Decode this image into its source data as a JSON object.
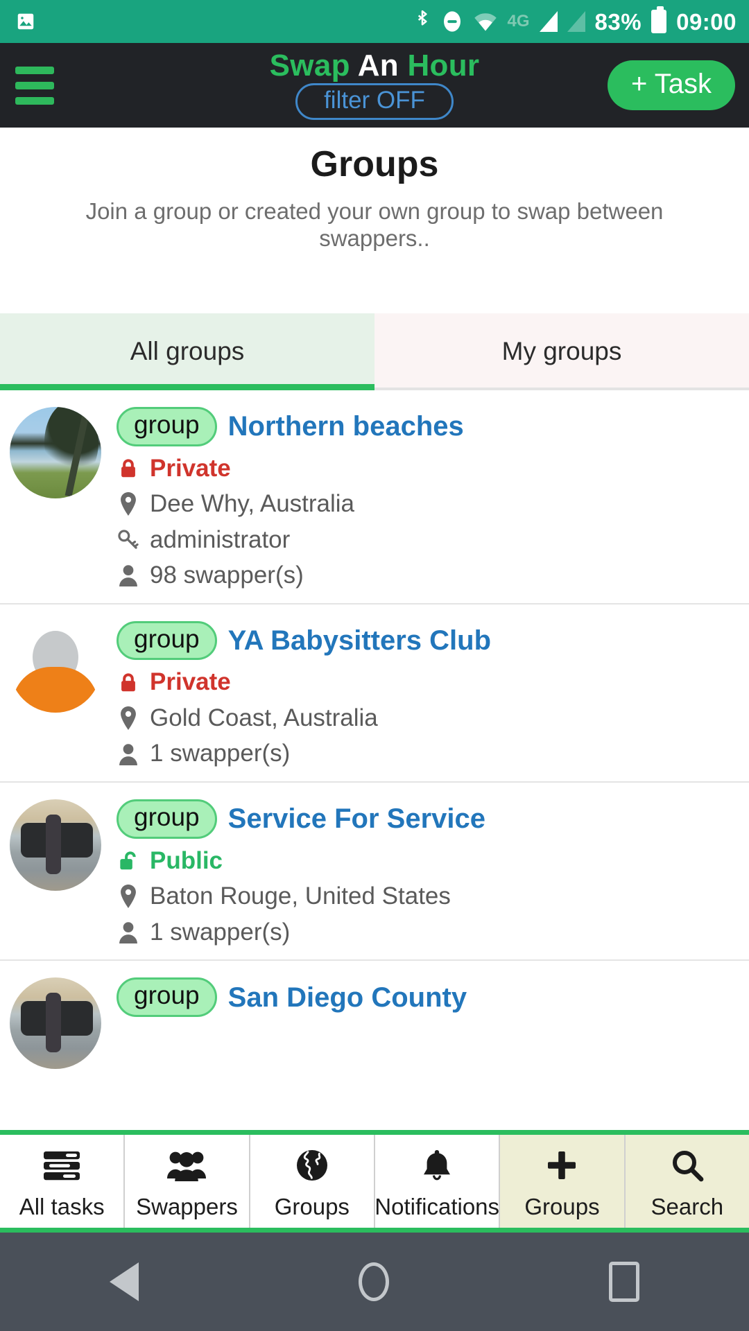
{
  "status_bar": {
    "left_icons": [
      "image-icon"
    ],
    "icons": [
      "bluetooth-icon",
      "do-not-disturb-icon",
      "wifi-icon"
    ],
    "network_label": "4G",
    "battery_percent": "83%",
    "time": "09:00",
    "background_color": "#19a47f"
  },
  "app_bar": {
    "menu_icon": "hamburger-menu-icon",
    "brand": {
      "part1": "Swap",
      "part2": "An",
      "part3": "Hour"
    },
    "filter_label": "filter OFF",
    "add_task_label": "+ Task",
    "background_color": "#212327",
    "accent_color": "#2bbd5e"
  },
  "page": {
    "title": "Groups",
    "subtitle": "Join a group or created your own group to swap between swappers.."
  },
  "tabs": [
    {
      "label": "All groups",
      "active": true
    },
    {
      "label": "My groups",
      "active": false
    }
  ],
  "groups": [
    {
      "badge": "group",
      "name": "Northern beaches",
      "privacy": "Private",
      "privacy_type": "private",
      "privacy_icon": "lock-closed-icon",
      "location": "Dee Why, Australia",
      "location_icon": "map-pin-icon",
      "role": "administrator",
      "role_icon": "key-icon",
      "members": "98 swapper(s)",
      "members_icon": "person-icon",
      "avatar": "lake-photo"
    },
    {
      "badge": "group",
      "name": "YA Babysitters Club",
      "privacy": "Private",
      "privacy_type": "private",
      "privacy_icon": "lock-closed-icon",
      "location": "Gold Coast, Australia",
      "location_icon": "map-pin-icon",
      "role": null,
      "role_icon": null,
      "members": "1 swapper(s)",
      "members_icon": "person-icon",
      "avatar": "default-person"
    },
    {
      "badge": "group",
      "name": "Service For Service",
      "privacy": "Public",
      "privacy_type": "public",
      "privacy_icon": "lock-open-icon",
      "location": "Baton Rouge, United States",
      "location_icon": "map-pin-icon",
      "role": null,
      "role_icon": null,
      "members": "1 swapper(s)",
      "members_icon": "person-icon",
      "avatar": "street-photo"
    },
    {
      "badge": "group",
      "name": "San Diego County",
      "privacy": null,
      "privacy_type": null,
      "privacy_icon": null,
      "location": null,
      "location_icon": null,
      "role": null,
      "role_icon": null,
      "members": null,
      "members_icon": null,
      "avatar": "partial-photo"
    }
  ],
  "bottom_bar": {
    "items": [
      {
        "label": "All tasks",
        "icon": "list-icon",
        "accent": false
      },
      {
        "label": "Swappers",
        "icon": "people-group-icon",
        "accent": false
      },
      {
        "label": "Groups",
        "icon": "globe-icon",
        "accent": false
      },
      {
        "label": "Notifications",
        "icon": "bell-icon",
        "accent": false
      },
      {
        "label": "Groups",
        "icon": "plus-icon",
        "accent": true
      },
      {
        "label": "Search",
        "icon": "search-icon",
        "accent": true
      }
    ],
    "accent_color": "#2bbd5e",
    "accent_tab_background": "#eeeed5"
  },
  "android_nav": {
    "back": "back-triangle-icon",
    "home": "home-circle-icon",
    "recent": "recents-square-icon",
    "background_color": "#4a5059"
  }
}
